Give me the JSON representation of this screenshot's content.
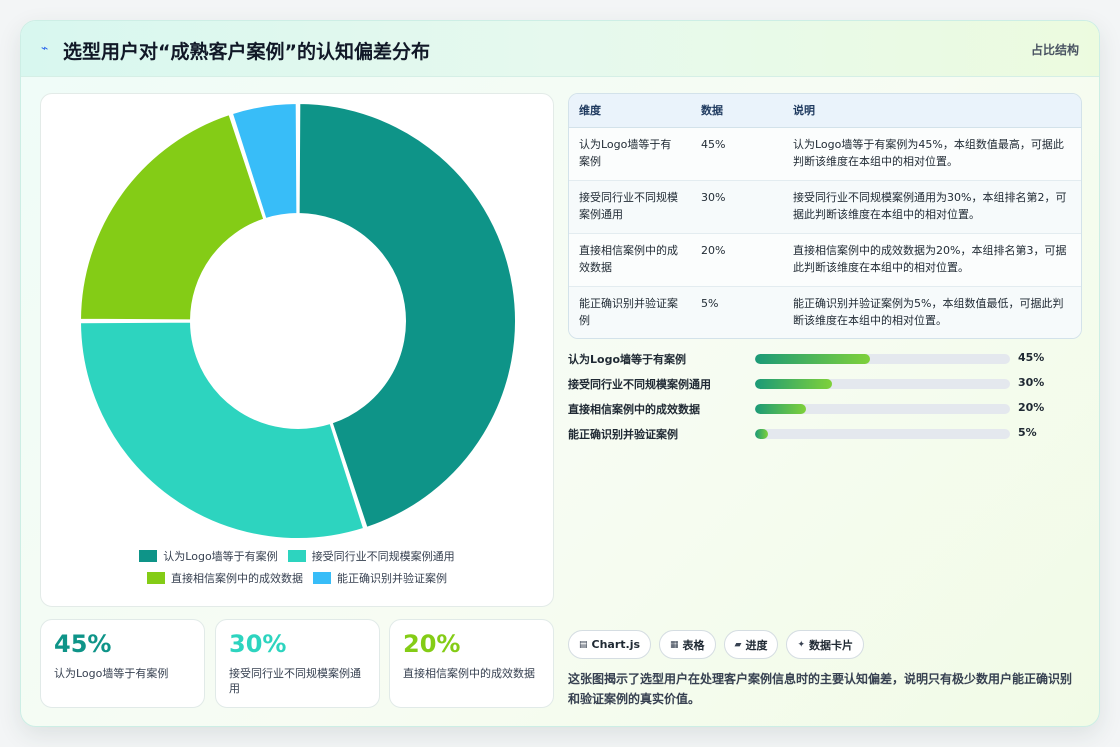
{
  "header": {
    "title": "选型用户对“成熟客户案例”的认知偏差分布",
    "tag": "占比结构",
    "icon": "lightning-icon"
  },
  "chart_data": {
    "type": "pie",
    "variant": "doughnut",
    "categories": [
      "认为Logo墙等于有案例",
      "接受同行业不同规模案例通用",
      "直接相信案例中的成效数据",
      "能正确识别并验证案例"
    ],
    "values": [
      45,
      30,
      20,
      5
    ],
    "unit": "%",
    "colors": [
      "#0e9488",
      "#2dd4bf",
      "#84cc16",
      "#38bdf8"
    ],
    "legend_position": "bottom"
  },
  "table": {
    "headers": [
      "维度",
      "数据",
      "说明"
    ],
    "rows": [
      [
        "认为Logo墙等于有案例",
        "45%",
        "认为Logo墙等于有案例为45%，本组数值最高，可据此判断该维度在本组中的相对位置。"
      ],
      [
        "接受同行业不同规模案例通用",
        "30%",
        "接受同行业不同规模案例通用为30%，本组排名第2，可据此判断该维度在本组中的相对位置。"
      ],
      [
        "直接相信案例中的成效数据",
        "20%",
        "直接相信案例中的成效数据为20%，本组排名第3，可据此判断该维度在本组中的相对位置。"
      ],
      [
        "能正确识别并验证案例",
        "5%",
        "能正确识别并验证案例为5%，本组数值最低，可据此判断该维度在本组中的相对位置。"
      ]
    ]
  },
  "bars": [
    {
      "label": "认为Logo墙等于有案例",
      "value": 45,
      "pct": "45%"
    },
    {
      "label": "接受同行业不同规模案例通用",
      "value": 30,
      "pct": "30%"
    },
    {
      "label": "直接相信案例中的成效数据",
      "value": 20,
      "pct": "20%"
    },
    {
      "label": "能正确识别并验证案例",
      "value": 5,
      "pct": "5%"
    }
  ],
  "stats": [
    {
      "value": "45%",
      "label": "认为Logo墙等于有案例",
      "color": "#0e9488"
    },
    {
      "value": "30%",
      "label": "接受同行业不同规模案例通用",
      "color": "#2dd4bf"
    },
    {
      "value": "20%",
      "label": "直接相信案例中的成效数据",
      "color": "#84cc16"
    }
  ],
  "chips": [
    {
      "icon": "chart-icon",
      "glyph": "▤",
      "label": "Chart.js"
    },
    {
      "icon": "table-icon",
      "glyph": "▦",
      "label": "表格"
    },
    {
      "icon": "progress-icon",
      "glyph": "▰",
      "label": "进度"
    },
    {
      "icon": "sparkle-icon",
      "glyph": "✦",
      "label": "数据卡片"
    }
  ],
  "summary": "这张图揭示了选型用户在处理客户案例信息时的主要认知偏差，说明只有极少数用户能正确识别和验证案例的真实价值。"
}
